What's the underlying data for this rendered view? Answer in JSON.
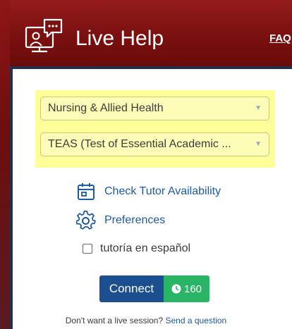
{
  "header": {
    "title": "Live Help",
    "faq_link": "FAQ"
  },
  "selects": {
    "subject": "Nursing & Allied Health",
    "topic": "TEAS (Test of Essential Academic ..."
  },
  "links": {
    "availability": "Check Tutor Availability",
    "preferences": "Preferences"
  },
  "spanish": {
    "label": "tutoría en español",
    "checked": false
  },
  "connect": {
    "label": "Connect",
    "count": "160"
  },
  "footer": {
    "prompt": "Don't want a live session?",
    "link": "Send a question"
  },
  "colors": {
    "header": "#7a1010",
    "accent_blue": "#1b4f8f",
    "accent_green": "#2ab566",
    "highlight": "#ffff9a"
  }
}
